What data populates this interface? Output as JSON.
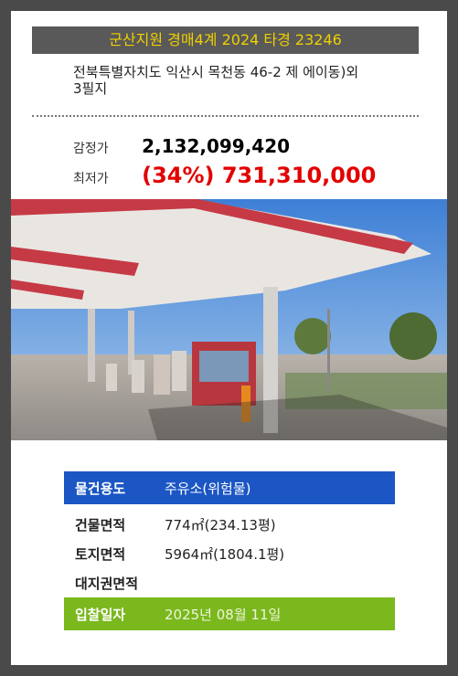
{
  "header": {
    "title": "군산지원 경매4계 2024 타경 23246"
  },
  "address": {
    "line1": "전북특별자치도 익산시 목천동 46-2  제 에이동)외",
    "line2": "3필지"
  },
  "prices": {
    "appraisal_label": "감정가",
    "appraisal_value": "2,132,099,420",
    "minimum_label": "최저가",
    "minimum_value": "(34%) 731,310,000"
  },
  "photo": {
    "icon": "gas-station-photo"
  },
  "details": {
    "usage_label": "물건용도",
    "usage_value": "주유소(위험물)",
    "building_label": "건물면적",
    "building_value": "774㎡(234.13평)",
    "land_label": "토지면적",
    "land_value": "5964㎡(1804.1평)",
    "landright_label": "대지권면적",
    "landright_value": "",
    "bid_label": "입찰일자",
    "bid_value": "2025년 08월 11일"
  },
  "colors": {
    "header_bg": "#595959",
    "header_text": "#f0d000",
    "minimum_price": "#e30000",
    "usage_bg": "#1b56c4",
    "bid_bg": "#7ab81e"
  }
}
